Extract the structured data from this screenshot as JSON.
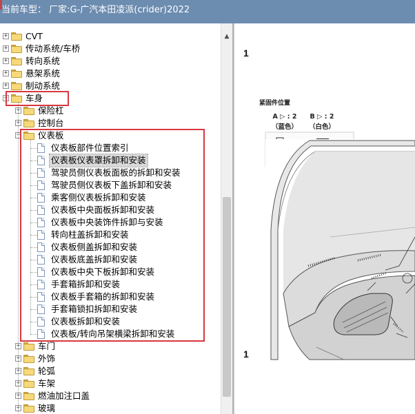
{
  "header": {
    "title": "当前车型：  厂家:G-广汽本田凌派(crider)2022"
  },
  "tree": {
    "top_items": [
      {
        "label": "CVT",
        "expander": "+"
      },
      {
        "label": "传动系统/车桥",
        "expander": "+"
      },
      {
        "label": "转向系统",
        "expander": "+"
      },
      {
        "label": "悬架系统",
        "expander": "+"
      },
      {
        "label": "制动系统",
        "expander": "+"
      },
      {
        "label": "车身",
        "expander": "−"
      }
    ],
    "body_children_before": [
      {
        "label": "保险杠",
        "expander": "+"
      },
      {
        "label": "控制台",
        "expander": "+"
      },
      {
        "label": "仪表板",
        "expander": "−"
      }
    ],
    "dashboard_docs": [
      "仪表板部件位置索引",
      "仪表板仪表罩拆卸和安装",
      "驾驶员侧仪表板面板的拆卸和安装",
      "驾驶员侧仪表板下盖拆卸和安装",
      "乘客侧仪表板拆卸和安装",
      "仪表板中央面板拆卸和安装",
      "仪表板中央装饰件拆卸与安装",
      "转向柱盖拆卸和安装",
      "仪表板侧盖拆卸和安装",
      "仪表板底盖拆卸和安装",
      "仪表板中央下板拆卸和安装",
      "手套箱拆卸和安装",
      "仪表板手套箱的拆卸和安装",
      "手套箱锁扣拆卸和安装",
      "仪表板拆卸和安装",
      "仪表板/转向吊架横梁拆卸和安装"
    ],
    "selected_doc_index": 1,
    "body_children_after": [
      {
        "label": "车门",
        "expander": "+"
      },
      {
        "label": "外饰",
        "expander": "+"
      },
      {
        "label": "轮弧",
        "expander": "+"
      },
      {
        "label": "车架",
        "expander": "+"
      },
      {
        "label": "燃油加注口盖",
        "expander": "+"
      },
      {
        "label": "玻璃",
        "expander": "+"
      }
    ]
  },
  "document": {
    "page_top": "1",
    "page_bottom": "1",
    "fastener_title": "紧固件位置",
    "clip_a_label": "A ▷ : 2",
    "clip_a_color": "（蓝色）",
    "clip_b_label": "B ▷ : 2",
    "clip_b_color": "（白色）"
  },
  "colors": {
    "highlight_box": "#d9363e",
    "titlebar": "#6c8cb0"
  }
}
